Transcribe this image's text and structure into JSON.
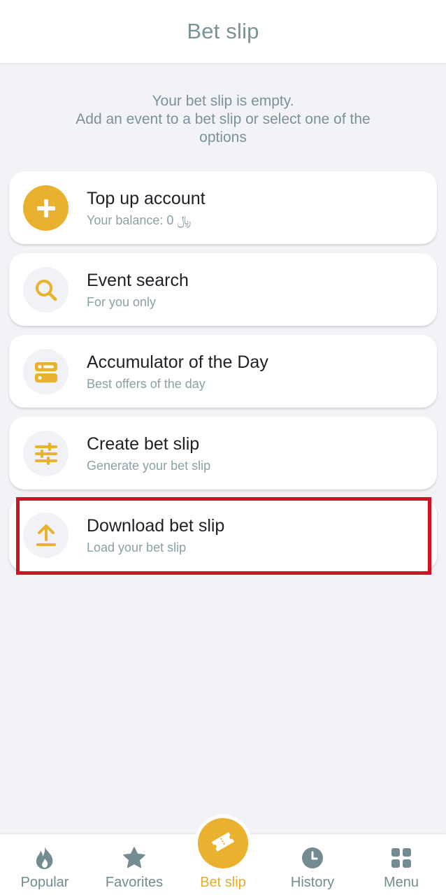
{
  "header": {
    "title": "Bet slip"
  },
  "empty": {
    "line1": "Your bet slip is empty.",
    "line2": "Add an event to a bet slip or select one of the",
    "line3": "options"
  },
  "cards": [
    {
      "title": "Top up account",
      "subtitle": "Your balance: 0 ﷼",
      "icon": "plus-icon"
    },
    {
      "title": "Event search",
      "subtitle": "For you only",
      "icon": "search-icon"
    },
    {
      "title": "Accumulator of the Day",
      "subtitle": "Best offers of the day",
      "icon": "accumulator-icon"
    },
    {
      "title": "Create bet slip",
      "subtitle": "Generate your bet slip",
      "icon": "sliders-icon"
    },
    {
      "title": "Download bet slip",
      "subtitle": "Load your bet slip",
      "icon": "upload-icon"
    }
  ],
  "nav": {
    "items": [
      {
        "label": "Popular",
        "icon": "fire-icon"
      },
      {
        "label": "Favorites",
        "icon": "star-icon"
      },
      {
        "label": "Bet slip",
        "icon": "ticket-icon",
        "active": true
      },
      {
        "label": "History",
        "icon": "clock-icon"
      },
      {
        "label": "Menu",
        "icon": "grid-icon"
      }
    ]
  },
  "colors": {
    "accent": "#eab12e",
    "muted_text": "#7a9298",
    "highlight": "#d01224"
  }
}
